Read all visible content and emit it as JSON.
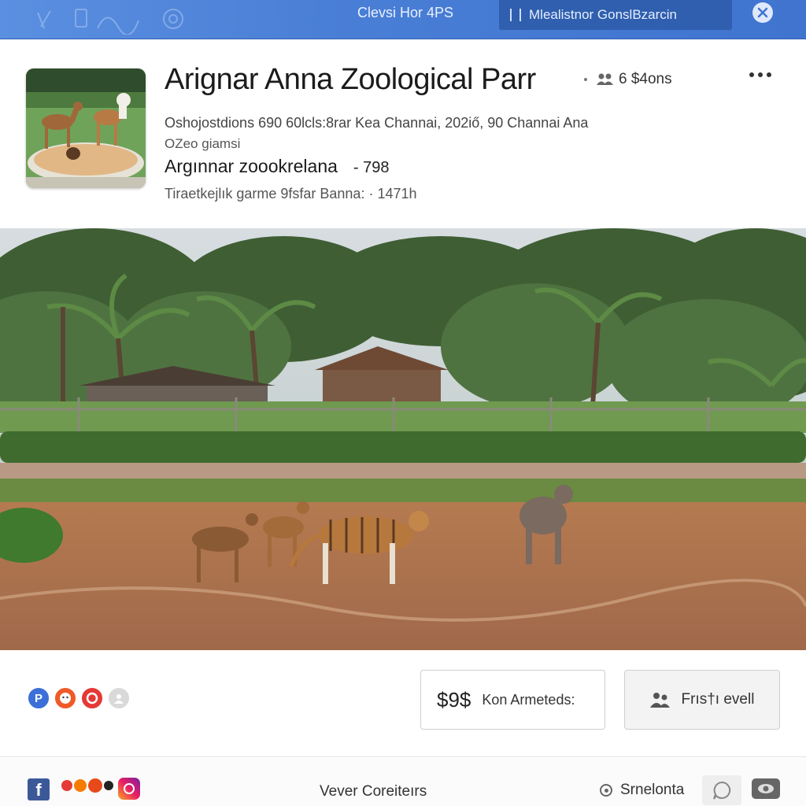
{
  "topbar": {
    "title": "Clevsi Hor 4PS",
    "search_label": "Mlealistnor GonslBzarcin"
  },
  "header": {
    "title": "Arignar Anna Zoological Parr",
    "people_count": "6 $4ons",
    "line1": "Oshojostdions 690 60lcls:8rar Kea Channai, 202iő, 90 Channai Ana",
    "line2": "OZeo giamsi",
    "subtitle": "Argınnar zoookrelana",
    "subtitle_num": "- 798",
    "line3": "Tiraetkejlık garme  9fsfar Banna:  · 1471h"
  },
  "actions": {
    "stat_num": "$9$",
    "stat_label": "Kon Armeteds:",
    "first_label": "Frıs†ı evell"
  },
  "avatars": [
    {
      "letter": "P",
      "color": "#3c6fd8"
    },
    {
      "letter": "",
      "color": "#f05a28"
    },
    {
      "letter": "",
      "color": "#e53935"
    },
    {
      "letter": "",
      "color": "#d9d9d9"
    }
  ],
  "footer": {
    "center_label": "Vever Coreiteırs",
    "right_label": "Srnelonta"
  },
  "colors": {
    "topbar": "#4a7fd6",
    "facebook": "#3b5998"
  }
}
